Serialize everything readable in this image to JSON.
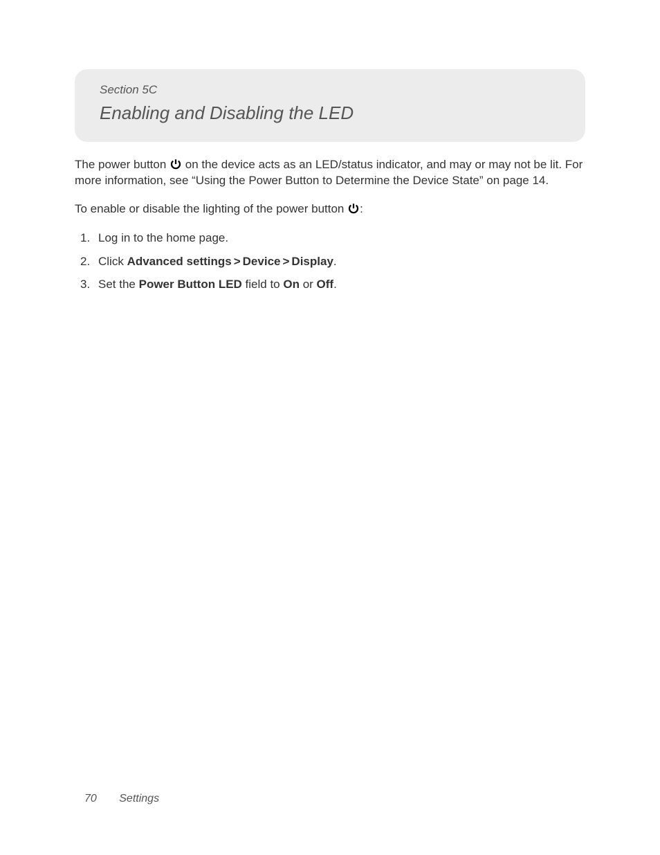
{
  "header": {
    "section_label": "Section 5C",
    "title": "Enabling and Disabling the LED"
  },
  "paragraph1": {
    "part1": "The power button ",
    "part2": " on the device acts as an LED/status indicator, and may or may not be lit. For more information, see “Using the Power Button to Determine the Device State” on page 14."
  },
  "paragraph2": {
    "part1": "To enable or disable the lighting of the power button ",
    "part2": ":"
  },
  "steps": {
    "step1": "Log in to the home page.",
    "step2": {
      "prefix": "Click ",
      "crumb1": "Advanced settings",
      "crumb2": "Device",
      "crumb3": "Display",
      "suffix": "."
    },
    "step3": {
      "part1": "Set the ",
      "field": "Power Button LED",
      "part2": " field to ",
      "opt1": "On",
      "part3": " or ",
      "opt2": "Off",
      "part4": "."
    }
  },
  "footer": {
    "page_number": "70",
    "chapter": "Settings"
  }
}
